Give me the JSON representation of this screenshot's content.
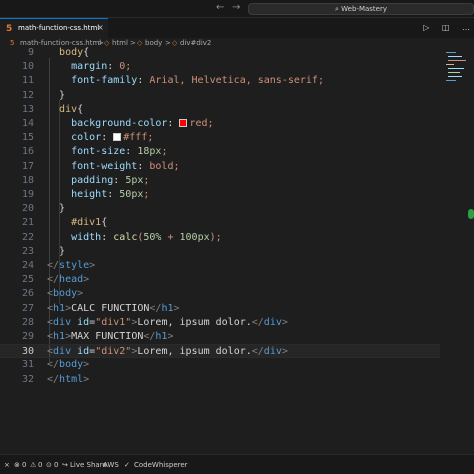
{
  "title_bar": {
    "back_icon": "arrow-left-icon",
    "forward_icon": "arrow-right-icon",
    "search_text": "Web-Mastery"
  },
  "tab": {
    "filename": "math-function-css.html",
    "icon": "html-file-icon"
  },
  "breadcrumb": {
    "items": [
      "math-function-css.html",
      "html",
      "body",
      "div#div2"
    ],
    "separator": ">"
  },
  "editor": {
    "current_line": "30",
    "lines": [
      {
        "n": "9",
        "text": "body{"
      },
      {
        "n": "10",
        "text": "margin: 0;"
      },
      {
        "n": "11",
        "text": "font-family: Arial, Helvetica, sans-serif;"
      },
      {
        "n": "12",
        "text": "}"
      },
      {
        "n": "13",
        "text": "div{"
      },
      {
        "n": "14",
        "text": "background-color: red;"
      },
      {
        "n": "15",
        "text": "color: #fff;"
      },
      {
        "n": "16",
        "text": "font-size: 18px;"
      },
      {
        "n": "17",
        "text": "font-weight: bold;"
      },
      {
        "n": "18",
        "text": "padding: 5px;"
      },
      {
        "n": "19",
        "text": "height: 50px;"
      },
      {
        "n": "20",
        "text": "}"
      },
      {
        "n": "21",
        "text": "#div1{"
      },
      {
        "n": "22",
        "text": "width: calc(50% + 100px);"
      },
      {
        "n": "23",
        "text": "}"
      },
      {
        "n": "24",
        "text": "</style>"
      },
      {
        "n": "25",
        "text": "</head>"
      },
      {
        "n": "26",
        "text": "<body>"
      },
      {
        "n": "27",
        "text": "<h1>CALC FUNCTION</h1>"
      },
      {
        "n": "28",
        "text": "<div id=\"div1\">Lorem, ipsum dolor.</div>"
      },
      {
        "n": "29",
        "text": "<h1>MAX FUNCTION</h1>"
      },
      {
        "n": "30",
        "text": "<div id=\"div2\">Lorem, ipsum dolor.</div>"
      },
      {
        "n": "31",
        "text": "</body>"
      },
      {
        "n": "32",
        "text": "</html>"
      }
    ],
    "swatch_red": "#ff0000",
    "swatch_white": "#ffffff"
  },
  "status_bar": {
    "errors": "0",
    "warnings": "0",
    "ports": "0",
    "live_share": "Live Share",
    "aws": "AWS",
    "codewhisperer": "CodeWhisperer"
  },
  "colors": {
    "background": "#1e1e1e",
    "tag": "#569cd6",
    "attribute": "#9cdcfe",
    "string": "#ce9178",
    "selector": "#d7ba7d",
    "number": "#b5cea8",
    "function": "#dcdcaa",
    "accent": "#0078d4",
    "scroll_marker": "#2ea043"
  }
}
